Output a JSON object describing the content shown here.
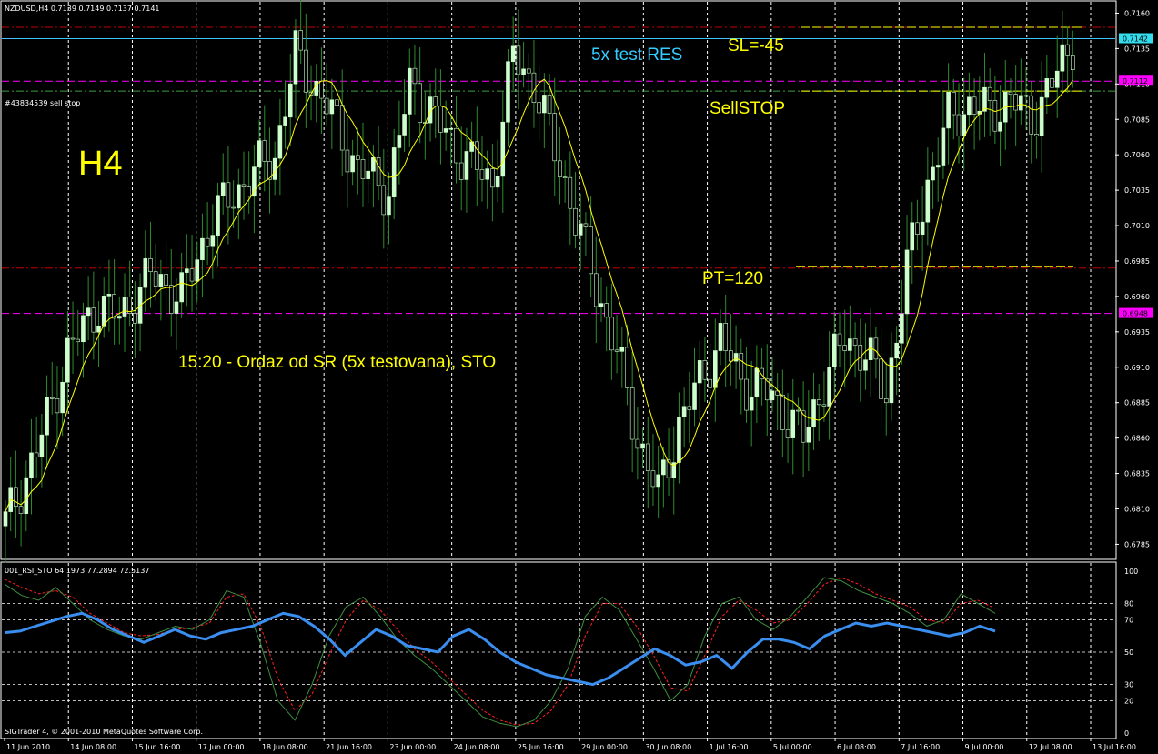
{
  "header": {
    "symbol_info": "NZDUSD,H4  0.7139 0.7149 0.7137 0.7141",
    "order_label": "#43834539 sell stop"
  },
  "indicator_header": "001_RSI_STO 64.1973 77.2894 72.5137",
  "footer": "SIGTrader 4, © 2001-2010 MetaQuotes Software Corp.",
  "annotations": {
    "timeframe": "H4",
    "resistance": "5x test RES",
    "stop_loss": "SL=-45",
    "sell_stop": "SellSTOP",
    "profit_target": "PT=120",
    "note": "15:20 - Ordaz od SR (5x testovana), STO"
  },
  "colors": {
    "background": "#000000",
    "axis": "#ffffff",
    "bull_candle": "#ccffcc",
    "wick": "#2e8b2e",
    "ma": "#ffff00",
    "rsi": "#3a8ef0",
    "sto_main": "#3e8e3e",
    "sto_signal": "#ff2020",
    "red_line": "#c00000",
    "magenta_line": "#ff00ff",
    "cyan_line": "#40c0ff",
    "green_line": "#40a040",
    "annotation_yellow": "#ffff00",
    "annotation_cyan": "#33ccff"
  },
  "chart_data": [
    {
      "type": "candlestick",
      "price_axis": [
        "0.7160",
        "0.7135",
        "0.7110",
        "0.7085",
        "0.7060",
        "0.7035",
        "0.7010",
        "0.6985",
        "0.6960",
        "0.6935",
        "0.6910",
        "0.6885",
        "0.6860",
        "0.6835",
        "0.6810",
        "0.6785"
      ],
      "ylim": [
        0.6775,
        0.7168
      ],
      "time_axis": [
        "11 Jun 2010",
        "14 Jun 08:00",
        "15 Jun 16:00",
        "17 Jun 00:00",
        "18 Jun 08:00",
        "21 Jun 16:00",
        "23 Jun 00:00",
        "24 Jun 08:00",
        "25 Jun 16:00",
        "29 Jun 00:00",
        "30 Jun 08:00",
        "1 Jul 16:00",
        "5 Jul 00:00",
        "6 Jul 08:00",
        "7 Jul 16:00",
        "9 Jul 00:00",
        "12 Jul 08:00",
        "13 Jul 16:00"
      ],
      "price_markers": [
        {
          "price": 0.7142,
          "text": "0.7142",
          "color": "#33ddee"
        },
        {
          "price": 0.7112,
          "text": "0.7112",
          "color": "#ff00ff"
        },
        {
          "price": 0.6948,
          "text": "0.6948",
          "color": "#ff00ff"
        }
      ],
      "levels": [
        {
          "price": 0.715,
          "color": "#c00000",
          "style": "dashdot"
        },
        {
          "price": 0.7142,
          "color": "#40c0ff",
          "style": "solid"
        },
        {
          "price": 0.7112,
          "color": "#ff00ff",
          "style": "dashed"
        },
        {
          "price": 0.7105,
          "color": "#40a040",
          "style": "dashdot"
        },
        {
          "price": 0.698,
          "color": "#c00000",
          "style": "dashdot"
        },
        {
          "price": 0.6948,
          "color": "#ff00ff",
          "style": "dashed"
        }
      ],
      "anchors": [
        [
          0,
          0.68
        ],
        [
          6,
          0.685
        ],
        [
          12,
          0.692
        ],
        [
          18,
          0.6955
        ],
        [
          22,
          0.6945
        ],
        [
          28,
          0.6975
        ],
        [
          34,
          0.696
        ],
        [
          40,
          0.7015
        ],
        [
          46,
          0.704
        ],
        [
          52,
          0.706
        ],
        [
          56,
          0.713
        ],
        [
          62,
          0.7095
        ],
        [
          68,
          0.705
        ],
        [
          74,
          0.7035
        ],
        [
          78,
          0.711
        ],
        [
          84,
          0.708
        ],
        [
          88,
          0.706
        ],
        [
          94,
          0.704
        ],
        [
          98,
          0.713
        ],
        [
          102,
          0.711
        ],
        [
          108,
          0.704
        ],
        [
          112,
          0.699
        ],
        [
          118,
          0.692
        ],
        [
          122,
          0.686
        ],
        [
          126,
          0.682
        ],
        [
          130,
          0.687
        ],
        [
          134,
          0.69
        ],
        [
          138,
          0.693
        ],
        [
          142,
          0.69
        ],
        [
          146,
          0.6895
        ],
        [
          150,
          0.688
        ],
        [
          154,
          0.686
        ],
        [
          158,
          0.69
        ],
        [
          162,
          0.693
        ],
        [
          166,
          0.692
        ],
        [
          170,
          0.689
        ],
        [
          174,
          0.698
        ],
        [
          178,
          0.704
        ],
        [
          182,
          0.7085
        ],
        [
          186,
          0.7095
        ],
        [
          190,
          0.709
        ],
        [
          194,
          0.71
        ],
        [
          198,
          0.7085
        ],
        [
          202,
          0.711
        ],
        [
          206,
          0.714
        ]
      ],
      "ma_color": "#ffff00"
    },
    {
      "type": "line",
      "name": "001_RSI_STO",
      "levels": [
        100,
        80,
        70,
        50,
        30,
        20,
        0
      ],
      "ylim": [
        0,
        100
      ],
      "rsi": [
        62,
        63,
        66,
        69,
        72,
        74,
        70,
        64,
        60,
        56,
        60,
        64,
        60,
        58,
        62,
        64,
        66,
        70,
        74,
        72,
        66,
        58,
        48,
        56,
        64,
        60,
        54,
        52,
        50,
        60,
        64,
        58,
        50,
        44,
        40,
        36,
        34,
        32,
        30,
        34,
        40,
        46,
        52,
        48,
        42,
        44,
        48,
        40,
        50,
        58,
        58,
        56,
        52,
        60,
        64,
        68,
        66,
        68,
        66,
        64,
        62,
        60,
        62,
        66,
        63
      ],
      "sto_main": [
        92,
        85,
        82,
        90,
        80,
        70,
        64,
        60,
        58,
        62,
        66,
        64,
        70,
        88,
        84,
        55,
        20,
        8,
        30,
        60,
        78,
        84,
        72,
        58,
        48,
        40,
        30,
        20,
        10,
        6,
        4,
        8,
        20,
        40,
        72,
        84,
        76,
        58,
        40,
        20,
        30,
        60,
        80,
        84,
        70,
        64,
        72,
        84,
        96,
        94,
        88,
        84,
        80,
        74,
        66,
        70,
        86,
        80,
        74
      ],
      "sto_signal": [
        95,
        90,
        86,
        88,
        84,
        74,
        68,
        62,
        60,
        61,
        64,
        65,
        68,
        84,
        86,
        66,
        34,
        14,
        24,
        48,
        70,
        82,
        76,
        64,
        52,
        44,
        34,
        24,
        14,
        8,
        5,
        6,
        14,
        30,
        60,
        80,
        80,
        66,
        48,
        28,
        26,
        48,
        72,
        82,
        76,
        68,
        70,
        80,
        92,
        96,
        92,
        86,
        82,
        78,
        70,
        68,
        80,
        82,
        77
      ]
    }
  ]
}
